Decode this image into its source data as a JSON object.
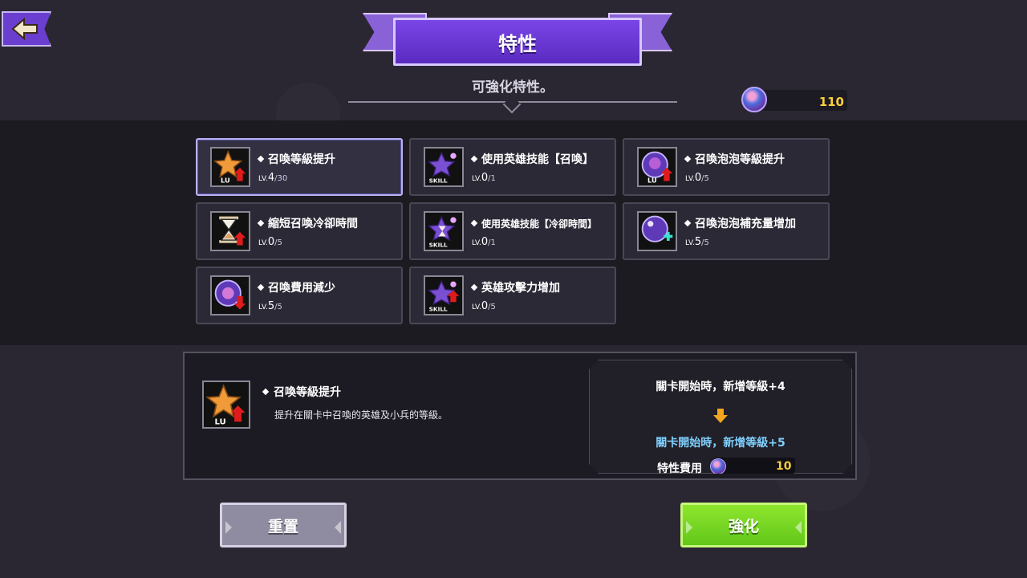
{
  "header": {
    "title": "特性",
    "subtitle": "可強化特性。",
    "currency_value": "110"
  },
  "traits": [
    {
      "name": "召喚等級提升",
      "lv_prefix": "LV.",
      "level": "4",
      "max": "/30",
      "icon": "orange-star-level-up-icon"
    },
    {
      "name": "使用英雄技能【召喚】",
      "lv_prefix": "LV.",
      "level": "0",
      "max": "/1",
      "icon": "purple-skill-icon"
    },
    {
      "name": "召喚泡泡等級提升",
      "lv_prefix": "LV.",
      "level": "0",
      "max": "/5",
      "icon": "bubble-level-up-icon"
    },
    {
      "name": "縮短召喚冷卻時間",
      "lv_prefix": "LV.",
      "level": "0",
      "max": "/5",
      "icon": "hourglass-icon"
    },
    {
      "name": "使用英雄技能【冷卻時間】",
      "lv_prefix": "LV.",
      "level": "0",
      "max": "/1",
      "icon": "skill-hourglass-icon"
    },
    {
      "name": "召喚泡泡補充量增加",
      "lv_prefix": "LV.",
      "level": "5",
      "max": "/5",
      "icon": "bubble-plus-icon"
    },
    {
      "name": "召喚費用減少",
      "lv_prefix": "LV.",
      "level": "5",
      "max": "/5",
      "icon": "bubble-cost-icon"
    },
    {
      "name": "英雄攻擊力增加",
      "lv_prefix": "LV.",
      "level": "0",
      "max": "/5",
      "icon": "skill-attack-icon"
    }
  ],
  "detail": {
    "name": "召喚等級提升",
    "description": "提升在關卡中召喚的英雄及小兵的等級。",
    "current_effect": "關卡開始時，新增等級+4",
    "next_effect": "關卡開始時，新增等級+5",
    "cost_label": "特性費用",
    "cost_value": "10"
  },
  "buttons": {
    "reset": "重置",
    "upgrade": "強化"
  },
  "colors": {
    "accent": "#6a3fcf",
    "currency": "#f7cf3c",
    "next_effect": "#7fd0ff",
    "upgrade_button": "#62c71a"
  }
}
